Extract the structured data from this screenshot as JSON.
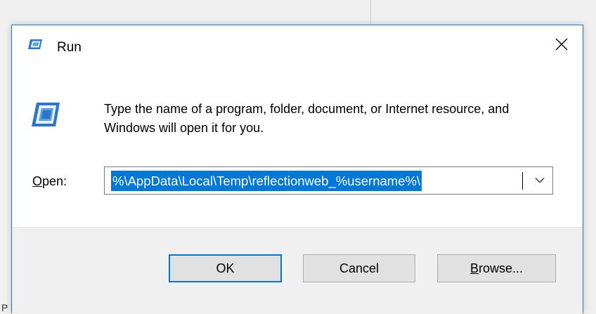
{
  "window": {
    "title": "Run",
    "close_glyph": "✕"
  },
  "description": "Type the name of a program, folder, document, or Internet resource, and Windows will open it for you.",
  "open_field": {
    "label_mnemonic": "O",
    "label_rest": "pen:",
    "value": "%\\AppData\\Local\\Temp\\reflectionweb_%username%\\"
  },
  "buttons": {
    "ok": "OK",
    "cancel": "Cancel",
    "browse_mnemonic": "B",
    "browse_rest": "rowse..."
  },
  "background": {
    "partial_char": "P"
  },
  "colors": {
    "accent": "#0078d7",
    "border": "#1979ca",
    "footer": "#f0f0f0"
  },
  "icons": {
    "title_icon": "run-icon",
    "content_icon": "run-icon",
    "close": "close-icon",
    "dropdown": "chevron-down-icon"
  }
}
